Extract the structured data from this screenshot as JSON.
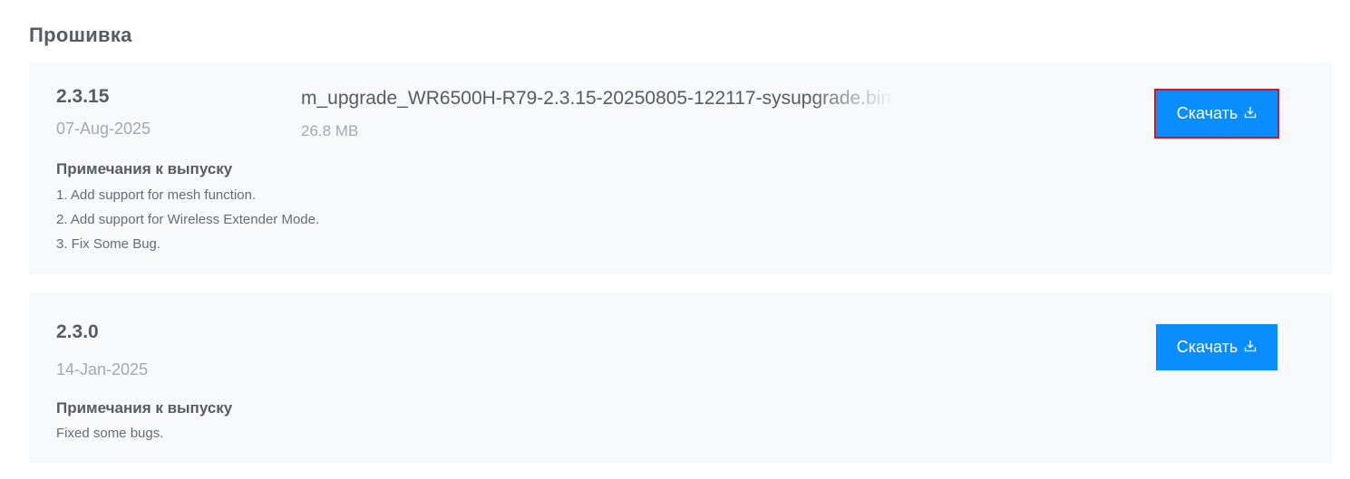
{
  "section": {
    "title": "Прошивка"
  },
  "releases": [
    {
      "version": "2.3.15",
      "date": "07-Aug-2025",
      "filename": "m_upgrade_WR6500H-R79-2.3.15-20250805-122117-sysupgrade.bin",
      "filesize": "26.8 MB",
      "notes_title": "Примечания к выпуску",
      "notes": [
        "1. Add support for mesh function.",
        "2. Add support for Wireless Extender Mode.",
        "3. Fix Some Bug."
      ],
      "download_label": "Скачать"
    },
    {
      "version": "2.3.0",
      "date": "14-Jan-2025",
      "notes_title": "Примечания к выпуску",
      "notes": [
        "Fixed some bugs."
      ],
      "download_label": "Скачать"
    }
  ],
  "colors": {
    "accent": "#0a8dff",
    "highlight": "#d9141b",
    "card_bg": "#f7f9fa"
  },
  "icons": {
    "download": "download-icon"
  }
}
